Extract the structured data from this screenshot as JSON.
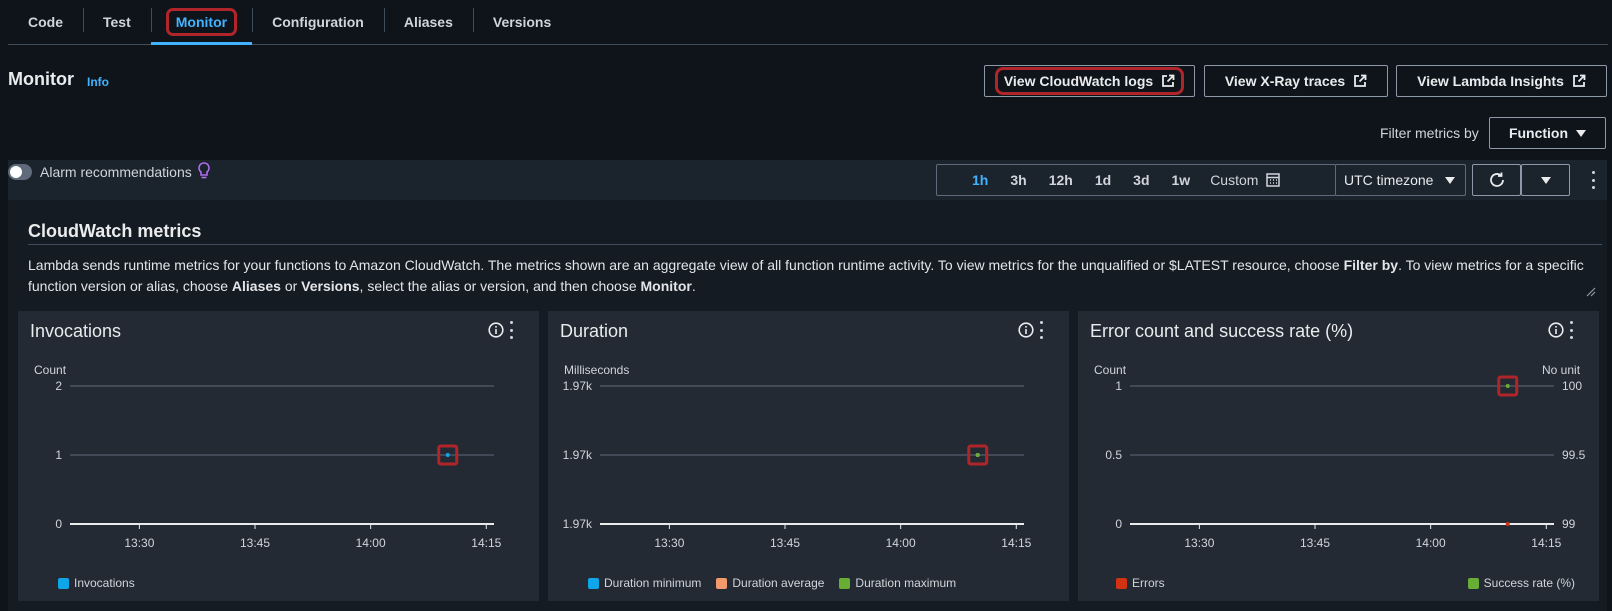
{
  "tabs": [
    "Code",
    "Test",
    "Monitor",
    "Configuration",
    "Aliases",
    "Versions"
  ],
  "header": {
    "title": "Monitor",
    "info": "Info"
  },
  "actions": {
    "cloudwatch_logs": "View CloudWatch logs",
    "xray_traces": "View X-Ray traces",
    "lambda_insights": "View Lambda Insights"
  },
  "filter": {
    "label": "Filter metrics by",
    "value": "Function"
  },
  "alarm": {
    "label": "Alarm recommendations",
    "enabled": false
  },
  "time_ranges": [
    "1h",
    "3h",
    "12h",
    "1d",
    "3d",
    "1w"
  ],
  "selected_range": "1h",
  "custom_label": "Custom",
  "timezone": "UTC timezone",
  "section": {
    "title": "CloudWatch metrics",
    "desc": {
      "p1": "Lambda sends runtime metrics for your functions to Amazon CloudWatch. The metrics shown are an aggregate view of all function runtime activity. To view metrics for the unqualified or $LATEST resource, choose ",
      "b1": "Filter by",
      "p2": ". To view metrics for a specific function version or alias, choose ",
      "b2": "Aliases",
      "p3": " or ",
      "b3": "Versions",
      "p4": ", select the alias or version, and then choose ",
      "b4": "Monitor",
      "p5": "."
    }
  },
  "colors": {
    "invocations": "#0ea5e9",
    "duration_min": "#0ea5e9",
    "duration_avg": "#f0996a",
    "duration_max": "#69ae34",
    "errors": "#d13212",
    "success": "#69ae34",
    "highlight": "#b0252a"
  },
  "cards": [
    {
      "title": "Invocations",
      "ylabel": "Count",
      "chart_data": {
        "type": "line",
        "x_ticks": [
          "13:30",
          "13:45",
          "14:00",
          "14:15"
        ],
        "y_ticks": [
          "2",
          "1",
          "0"
        ],
        "ylim": [
          0,
          2
        ],
        "series": [
          {
            "name": "Invocations",
            "x": [
              "14:10"
            ],
            "values": [
              1
            ]
          }
        ]
      }
    },
    {
      "title": "Duration",
      "ylabel": "Milliseconds",
      "chart_data": {
        "type": "line",
        "x_ticks": [
          "13:30",
          "13:45",
          "14:00",
          "14:15"
        ],
        "y_ticks": [
          "1.97k",
          "1.97k",
          "1.97k"
        ],
        "series": [
          {
            "name": "Duration minimum",
            "x": [
              "14:10"
            ],
            "values": [
              1970
            ]
          },
          {
            "name": "Duration average",
            "x": [
              "14:10"
            ],
            "values": [
              1970
            ]
          },
          {
            "name": "Duration maximum",
            "x": [
              "14:10"
            ],
            "values": [
              1970
            ]
          }
        ]
      }
    },
    {
      "title": "Error count and success rate (%)",
      "ylabel": "Count",
      "ylabel_right": "No unit",
      "chart_data": {
        "type": "line",
        "x_ticks": [
          "13:30",
          "13:45",
          "14:00",
          "14:15"
        ],
        "y_ticks": [
          "1",
          "0.5",
          "0"
        ],
        "y2_ticks": [
          "100",
          "99.5",
          "99"
        ],
        "ylim": [
          0,
          1
        ],
        "y2lim": [
          99,
          100
        ],
        "series": [
          {
            "name": "Errors",
            "x": [
              "14:10"
            ],
            "values": [
              0
            ]
          },
          {
            "name": "Success rate (%)",
            "x": [
              "14:10"
            ],
            "values": [
              100
            ],
            "axis": "right"
          }
        ]
      }
    }
  ]
}
